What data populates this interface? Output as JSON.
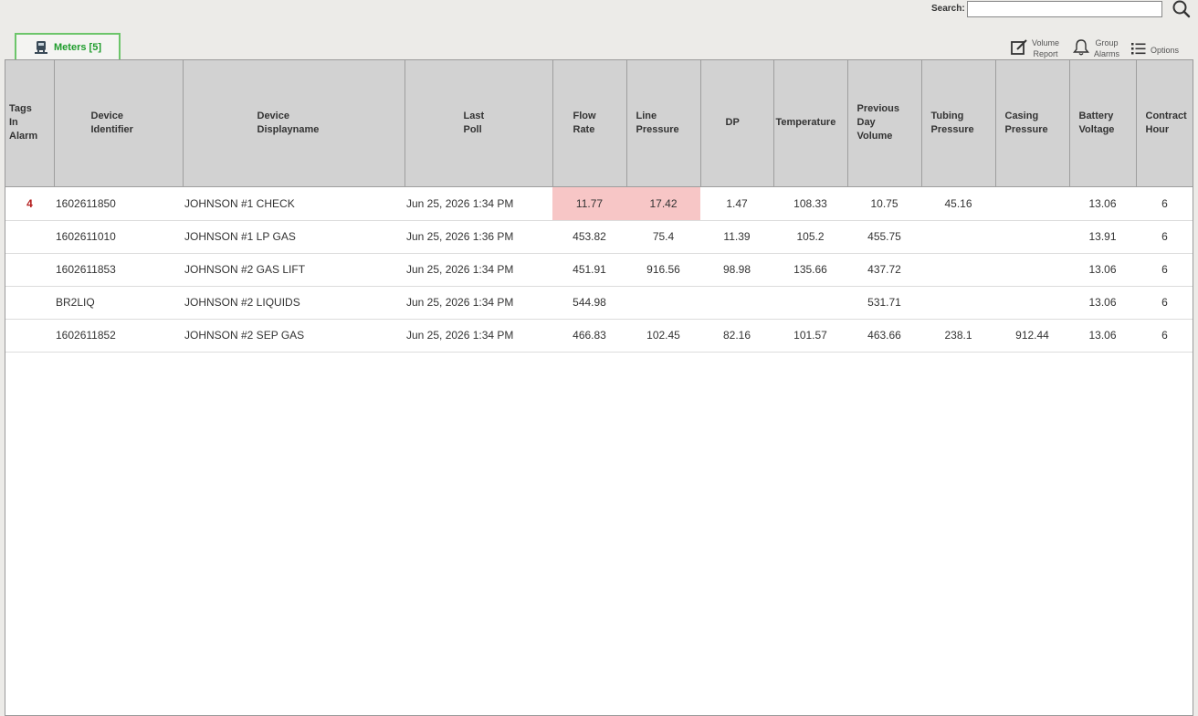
{
  "search": {
    "label": "Search:",
    "value": ""
  },
  "tab": {
    "label": "Meters [5]",
    "icon": "meter-icon"
  },
  "toolbar": {
    "volume_report": "Volume\nReport",
    "group_alarms": "Group\nAlarms",
    "options": "Options"
  },
  "colors": {
    "accent": "#1e9c2c",
    "alarm_cell": "#f7c6c6",
    "alarm_text": "#b31b1b",
    "header_bg": "#d2d2d2"
  },
  "table": {
    "columns": [
      "Tags\nIn\nAlarm",
      "Device\nIdentifier",
      "Device\nDisplayname",
      "Last\nPoll",
      "Flow\nRate",
      "Line\nPressure",
      "DP",
      "Temperature",
      "Previous\nDay\nVolume",
      "Tubing\nPressure",
      "Casing\nPressure",
      "Battery\nVoltage",
      "Contract\nHour"
    ],
    "rows": [
      [
        "4",
        "1602611850",
        "JOHNSON #1 CHECK",
        "Jun 25, 2026 1:34 PM",
        "11.77",
        "17.42",
        "1.47",
        "108.33",
        "10.75",
        "45.16",
        "",
        "13.06",
        "6"
      ],
      [
        "",
        "1602611010",
        "JOHNSON #1 LP GAS",
        "Jun 25, 2026 1:36 PM",
        "453.82",
        "75.4",
        "11.39",
        "105.2",
        "455.75",
        "",
        "",
        "13.91",
        "6"
      ],
      [
        "",
        "1602611853",
        "JOHNSON #2 GAS LIFT",
        "Jun 25, 2026 1:34 PM",
        "451.91",
        "916.56",
        "98.98",
        "135.66",
        "437.72",
        "",
        "",
        "13.06",
        "6"
      ],
      [
        "",
        "BR2LIQ",
        "JOHNSON #2 LIQUIDS",
        "Jun 25, 2026 1:34 PM",
        "544.98",
        "",
        "",
        "",
        "531.71",
        "",
        "",
        "13.06",
        "6"
      ],
      [
        "",
        "1602611852",
        "JOHNSON #2 SEP GAS",
        "Jun 25, 2026 1:34 PM",
        "466.83",
        "102.45",
        "82.16",
        "101.57",
        "463.66",
        "238.1",
        "912.44",
        "13.06",
        "6"
      ]
    ]
  }
}
